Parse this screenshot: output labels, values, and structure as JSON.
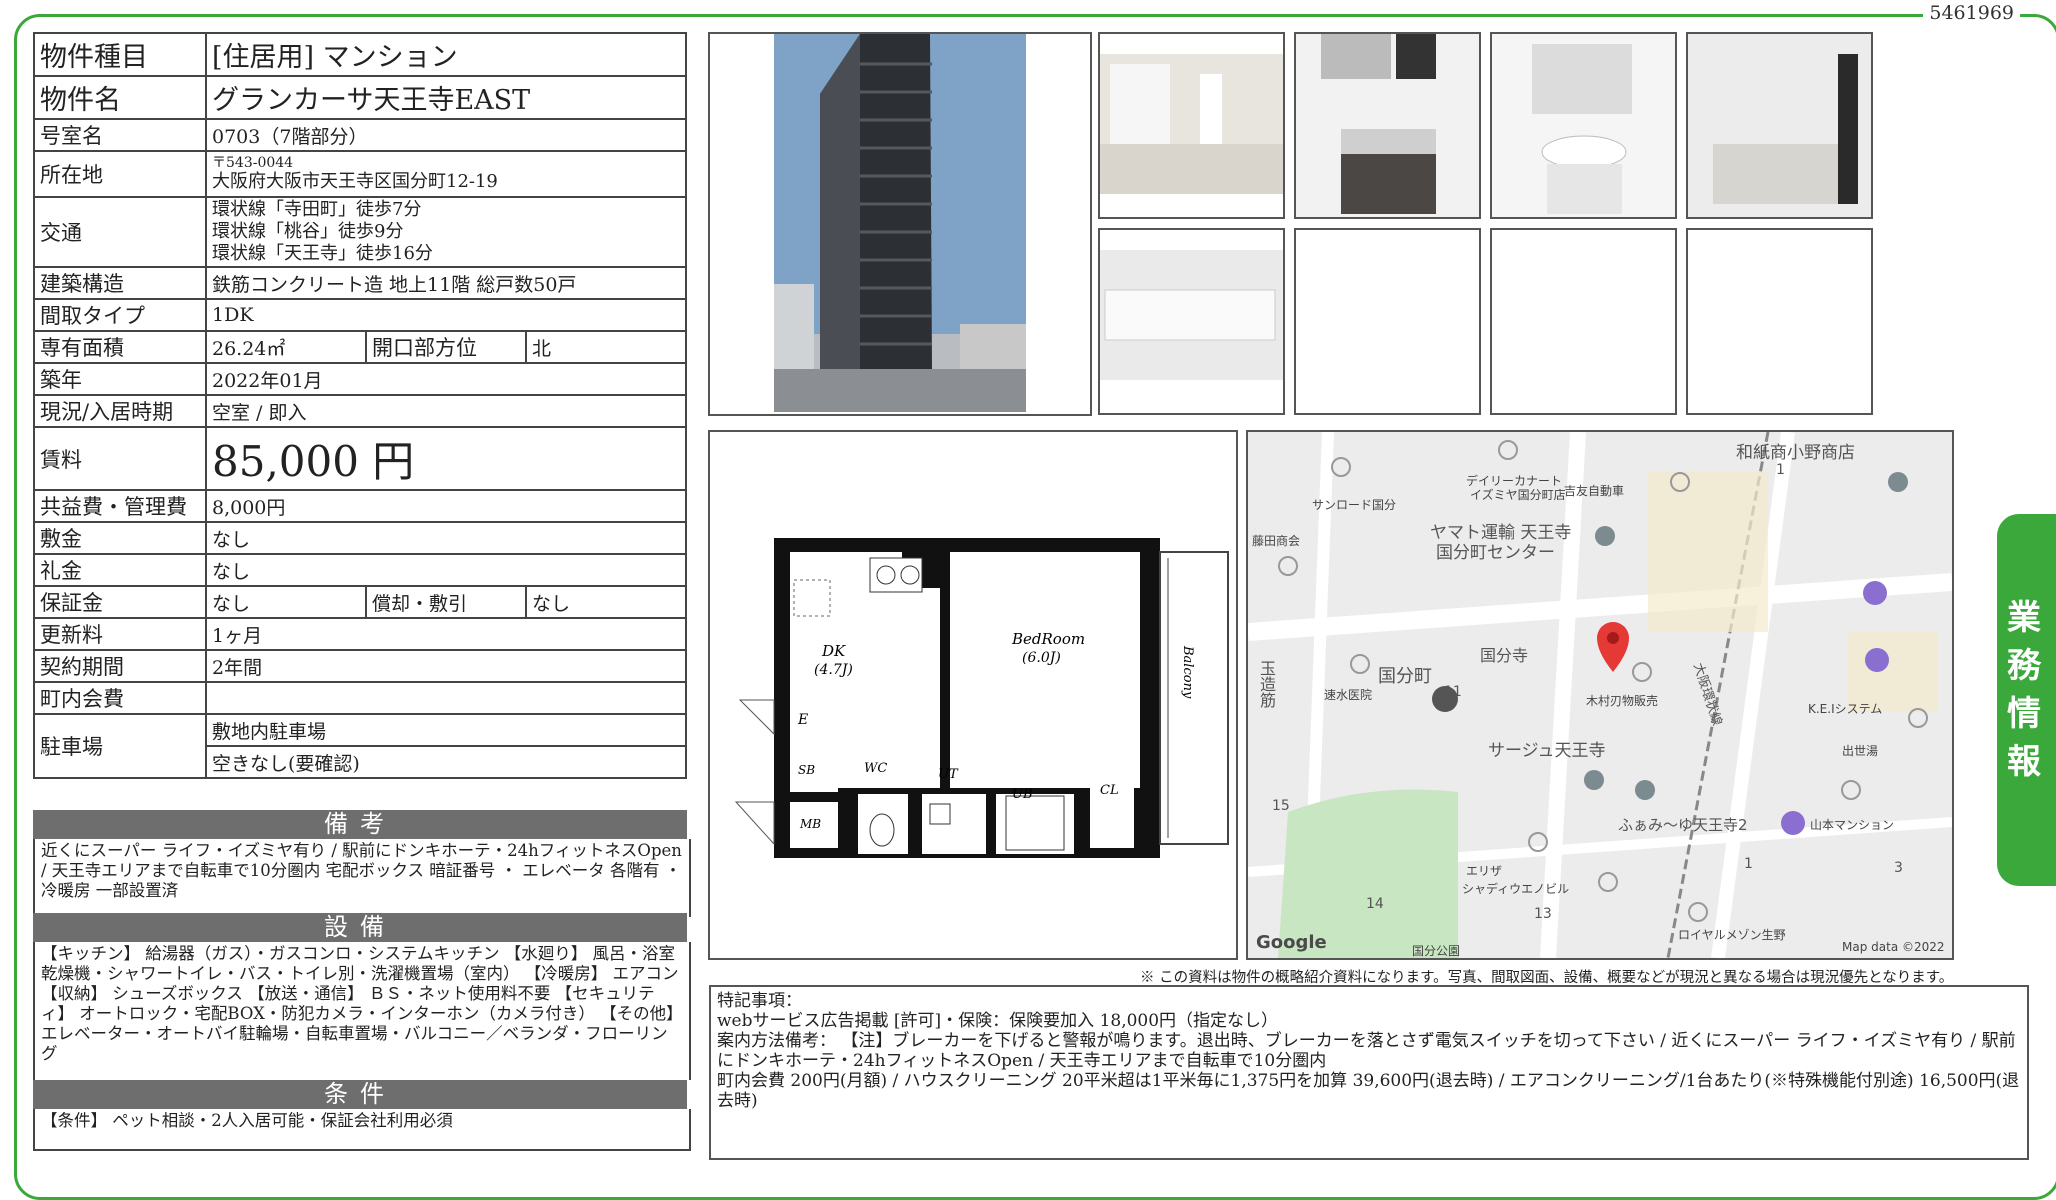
{
  "sheet_id": "5461969",
  "side_tab": "業務情報",
  "rows": {
    "type": {
      "label": "物件種目",
      "value": "[住居用]  マンション"
    },
    "name": {
      "label": "物件名",
      "value": "グランカーサ天王寺EAST"
    },
    "room": {
      "label": "号室名",
      "value": "0703（7階部分）"
    },
    "address": {
      "label": "所在地",
      "postal": "〒543-0044",
      "value": "大阪府大阪市天王寺区国分町12-19"
    },
    "transport": {
      "label": "交通",
      "lines": [
        "環状線「寺田町」徒歩7分",
        "環状線「桃谷」徒歩9分",
        "環状線「天王寺」徒歩16分"
      ]
    },
    "structure": {
      "label": "建築構造",
      "value": "鉄筋コンクリート造 地上11階 総戸数50戸"
    },
    "layout": {
      "label": "間取タイプ",
      "value": "1DK"
    },
    "area": {
      "label": "専有面積",
      "value": "26.24㎡",
      "dir_label": "開口部方位",
      "dir_value": "北"
    },
    "built": {
      "label": "築年",
      "value": "2022年01月"
    },
    "status": {
      "label": "現況/入居時期",
      "value": "空室 / 即入"
    },
    "rent": {
      "label": "賃料",
      "value": "85,000 円"
    },
    "fee": {
      "label": "共益費・管理費",
      "value": "8,000円"
    },
    "deposit": {
      "label": "敷金",
      "value": "なし"
    },
    "key_money": {
      "label": "礼金",
      "value": "なし"
    },
    "guarantee": {
      "label": "保証金",
      "value": "なし",
      "amort_label": "償却・敷引",
      "amort_value": "なし"
    },
    "renewal": {
      "label": "更新料",
      "value": "1ヶ月"
    },
    "contract": {
      "label": "契約期間",
      "value": "2年間"
    },
    "town_fee": {
      "label": "町内会費",
      "value": ""
    },
    "parking": {
      "label": "駐車場",
      "value1": "敷地内駐車場",
      "value2": "空きなし(要確認)"
    }
  },
  "sections": {
    "notes": {
      "title": "備考",
      "text": "近くにスーパー ライフ・イズミヤ有り / 駅前にドンキホーテ・24hフィットネスOpen / 天王寺エリアまで自転車で10分圏内 宅配ボックス 暗証番号 ・ エレベータ 各階有 ・ 冷暖房 一部設置済"
    },
    "equipment": {
      "title": "設備",
      "text": "【キッチン】 給湯器（ガス）・ガスコンロ・システムキッチン 【水廻り】 風呂・浴室乾燥機・シャワートイレ・バス・トイレ別・洗濯機置場（室内） 【冷暖房】 エアコン 【収納】 シューズボックス 【放送・通信】 ＢＳ・ネット使用料不要 【セキュリティ】 オートロック・宅配BOX・防犯カメラ・インターホン（カメラ付き） 【その他】 エレベーター・オートバイ駐輪場・自転車置場・バルコニー／ベランダ・フローリング"
    },
    "conditions": {
      "title": "条件",
      "text": "【条件】 ペット相談・2人入居可能・保証会社利用必須"
    }
  },
  "floorplan": {
    "dk": "DK",
    "dk_size": "(4.7J)",
    "bed": "BedRoom",
    "bed_size": "(6.0J)",
    "balcony": "Balcony",
    "e": "E",
    "sb": "SB",
    "wc": "WC",
    "ut": "UT",
    "ub": "UB",
    "cl": "CL",
    "mb": "MB"
  },
  "map_labels": {
    "l1": "和紙商小野商店",
    "l2": "デイリーカナート",
    "l3": "イズミヤ国分町店",
    "l4": "吉友自動車",
    "l5": "サンロード国分",
    "l6": "藤田商会",
    "l7": "ヤマト運輸 天王寺",
    "l8": "国分町センター",
    "l9": "国分寺",
    "l10": "国分町",
    "l11": "玉造筋",
    "l12": "速水医院",
    "l13": "木村刃物販売",
    "l14": "大阪環状線",
    "l15": "K.E.Iシステム",
    "l16": "出世湯",
    "l17": "サージュ天王寺",
    "l18": "ふぁみ〜ゆ天王寺2",
    "l19": "山本マンション",
    "l20": "エリザ",
    "l21": "シャディウエノビル",
    "l22": "ロイヤルメゾン生野",
    "n11": "11",
    "n15": "15",
    "n14": "14",
    "n13": "13",
    "n1a": "1",
    "n1b": "1",
    "n3": "3",
    "google": "Google",
    "mapdata": "Map data ©2022",
    "park": "国分公園"
  },
  "notice": "※ この資料は物件の概略紹介資料になります。写真、間取図面、設備、概要などが現況と異なる場合は現況優先となります。",
  "remarks": {
    "title": "特記事項：",
    "lines": [
      "webサービス広告掲載 [許可]・保険：保険要加入 18,000円（指定なし）",
      "案内方法備考： 【注】ブレーカーを下げると警報が鳴ります。退出時、ブレーカーを落とさず電気スイッチを切って下さい / 近くにスーパー ライフ・イズミヤ有り / 駅前にドンキホーテ・24hフィットネスOpen / 天王寺エリアまで自転車で10分圏内",
      "町内会費 200円(月額) / ハウスクリーニング 20平米超は1平米毎に1,375円を加算 39,600円(退去時) / エアコンクリーニング/1台あたり(※特殊機能付別途) 16,500円(退去時)"
    ]
  },
  "colors": {
    "frame": "#3aa83a",
    "section_header": "#6e6e6e",
    "map_bg": "#ededed",
    "map_pin": "#e53935"
  }
}
